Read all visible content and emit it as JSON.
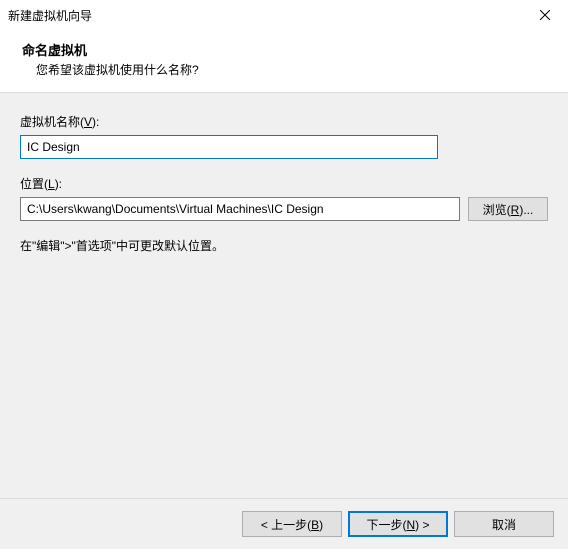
{
  "window": {
    "title": "新建虚拟机向导"
  },
  "header": {
    "title": "命名虚拟机",
    "subtitle": "您希望该虚拟机使用什么名称?"
  },
  "fields": {
    "vm_name": {
      "label_prefix": "虚拟机名称(",
      "label_accel": "V",
      "label_suffix": "):",
      "value": "IC Design"
    },
    "location": {
      "label_prefix": "位置(",
      "label_accel": "L",
      "label_suffix": "):",
      "value": "C:\\Users\\kwang\\Documents\\Virtual Machines\\IC Design",
      "browse_prefix": "浏览(",
      "browse_accel": "R",
      "browse_suffix": ")..."
    }
  },
  "hint": "在\"编辑\">\"首选项\"中可更改默认位置。",
  "footer": {
    "back_prefix": "< 上一步(",
    "back_accel": "B",
    "back_suffix": ")",
    "next_prefix": "下一步(",
    "next_accel": "N",
    "next_suffix": ") >",
    "cancel": "取消"
  }
}
